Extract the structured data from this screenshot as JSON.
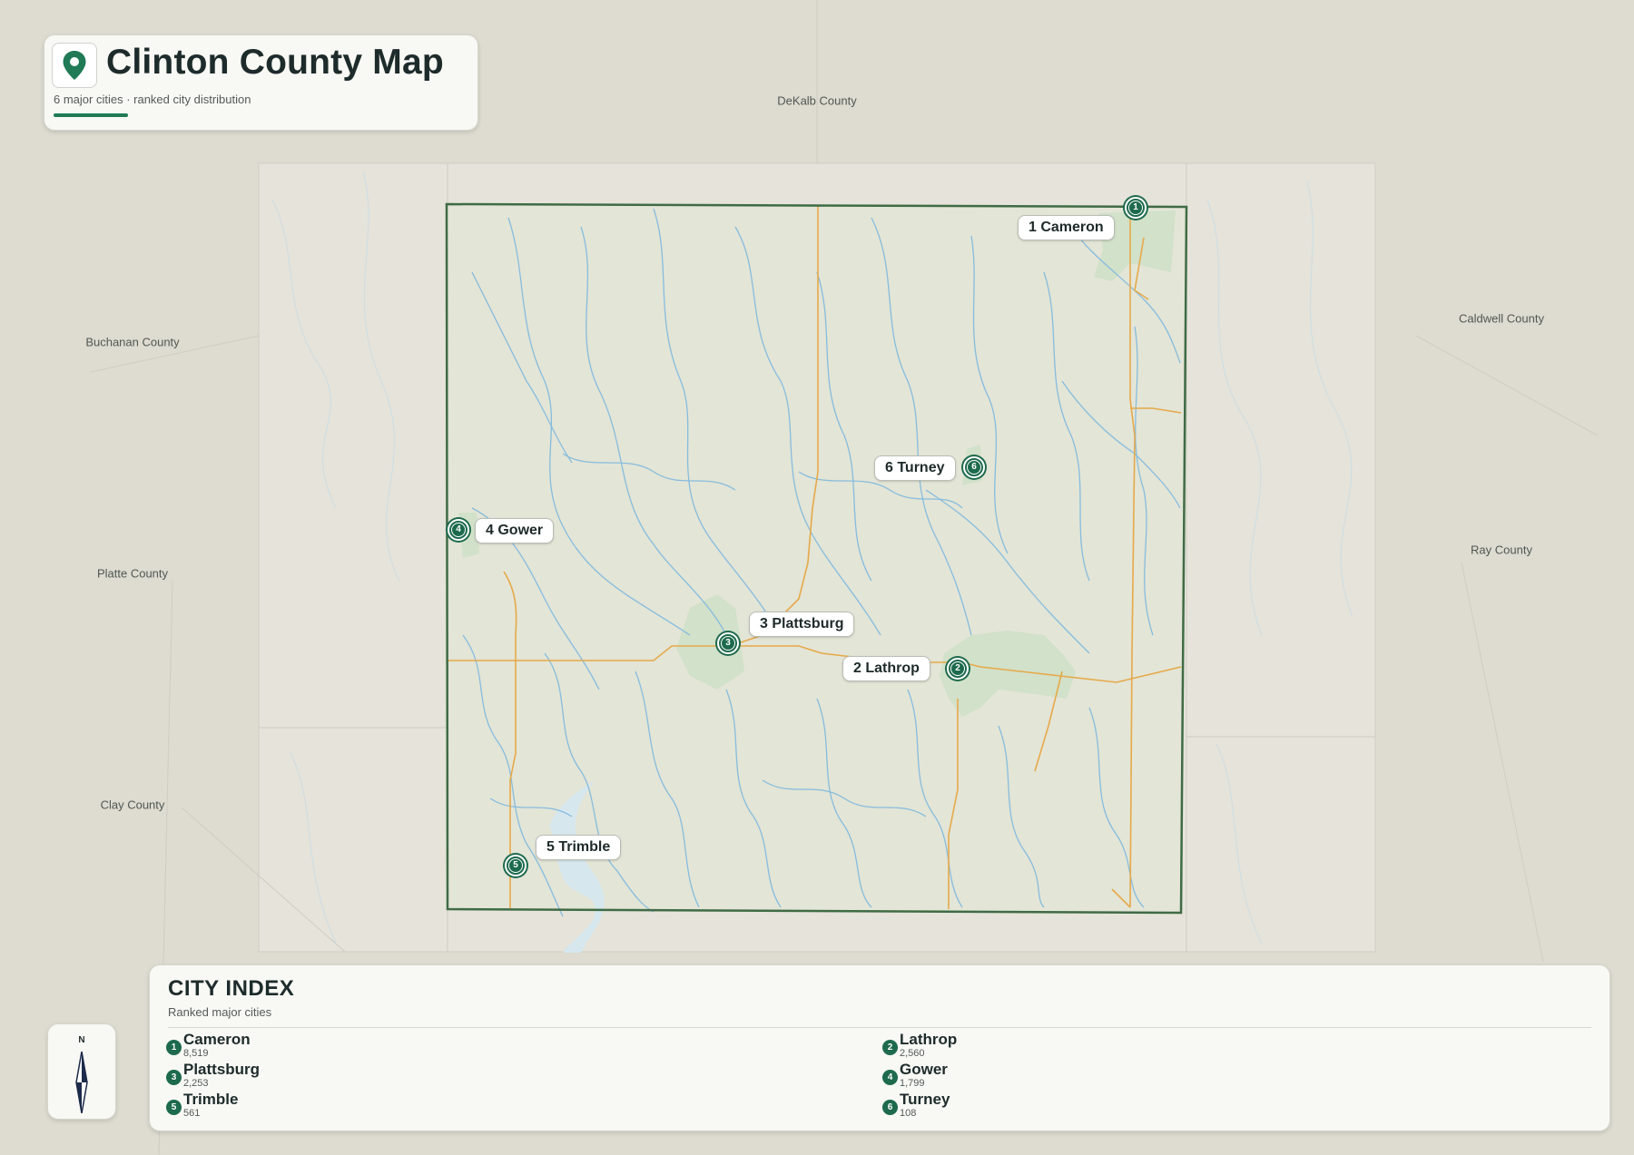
{
  "header": {
    "title": "Clinton County Map",
    "subtitle": "6 major cities · ranked city distribution",
    "icon": "map-pin-icon",
    "accent_color": "#1f7a55"
  },
  "neighbors": [
    {
      "name": "DeKalb County"
    },
    {
      "name": "Buchanan County"
    },
    {
      "name": "Caldwell County"
    },
    {
      "name": "Platte County"
    },
    {
      "name": "Ray County"
    },
    {
      "name": "Clay County"
    }
  ],
  "cities": [
    {
      "rank": "1",
      "name": "Cameron",
      "label": "1 Cameron",
      "population": "8,519"
    },
    {
      "rank": "2",
      "name": "Lathrop",
      "label": "2 Lathrop",
      "population": "2,560"
    },
    {
      "rank": "3",
      "name": "Plattsburg",
      "label": "3 Plattsburg",
      "population": "2,253"
    },
    {
      "rank": "4",
      "name": "Gower",
      "label": "4 Gower",
      "population": "1,799"
    },
    {
      "rank": "5",
      "name": "Trimble",
      "label": "5 Trimble",
      "population": "561"
    },
    {
      "rank": "6",
      "name": "Turney",
      "label": "6 Turney",
      "population": "108"
    }
  ],
  "compass": {
    "label": "N",
    "icon": "north-arrow-icon"
  },
  "index": {
    "title": "CITY INDEX",
    "subtitle": "Ranked major cities"
  },
  "colors": {
    "background": "#dedbd0",
    "county_fill": "#e3e5d6",
    "county_border": "#3f6b45",
    "rivers": "#7fb8dc",
    "roads": "#e6a94a",
    "marker": "#1d6a4d",
    "urban": "#cfe0c8"
  }
}
